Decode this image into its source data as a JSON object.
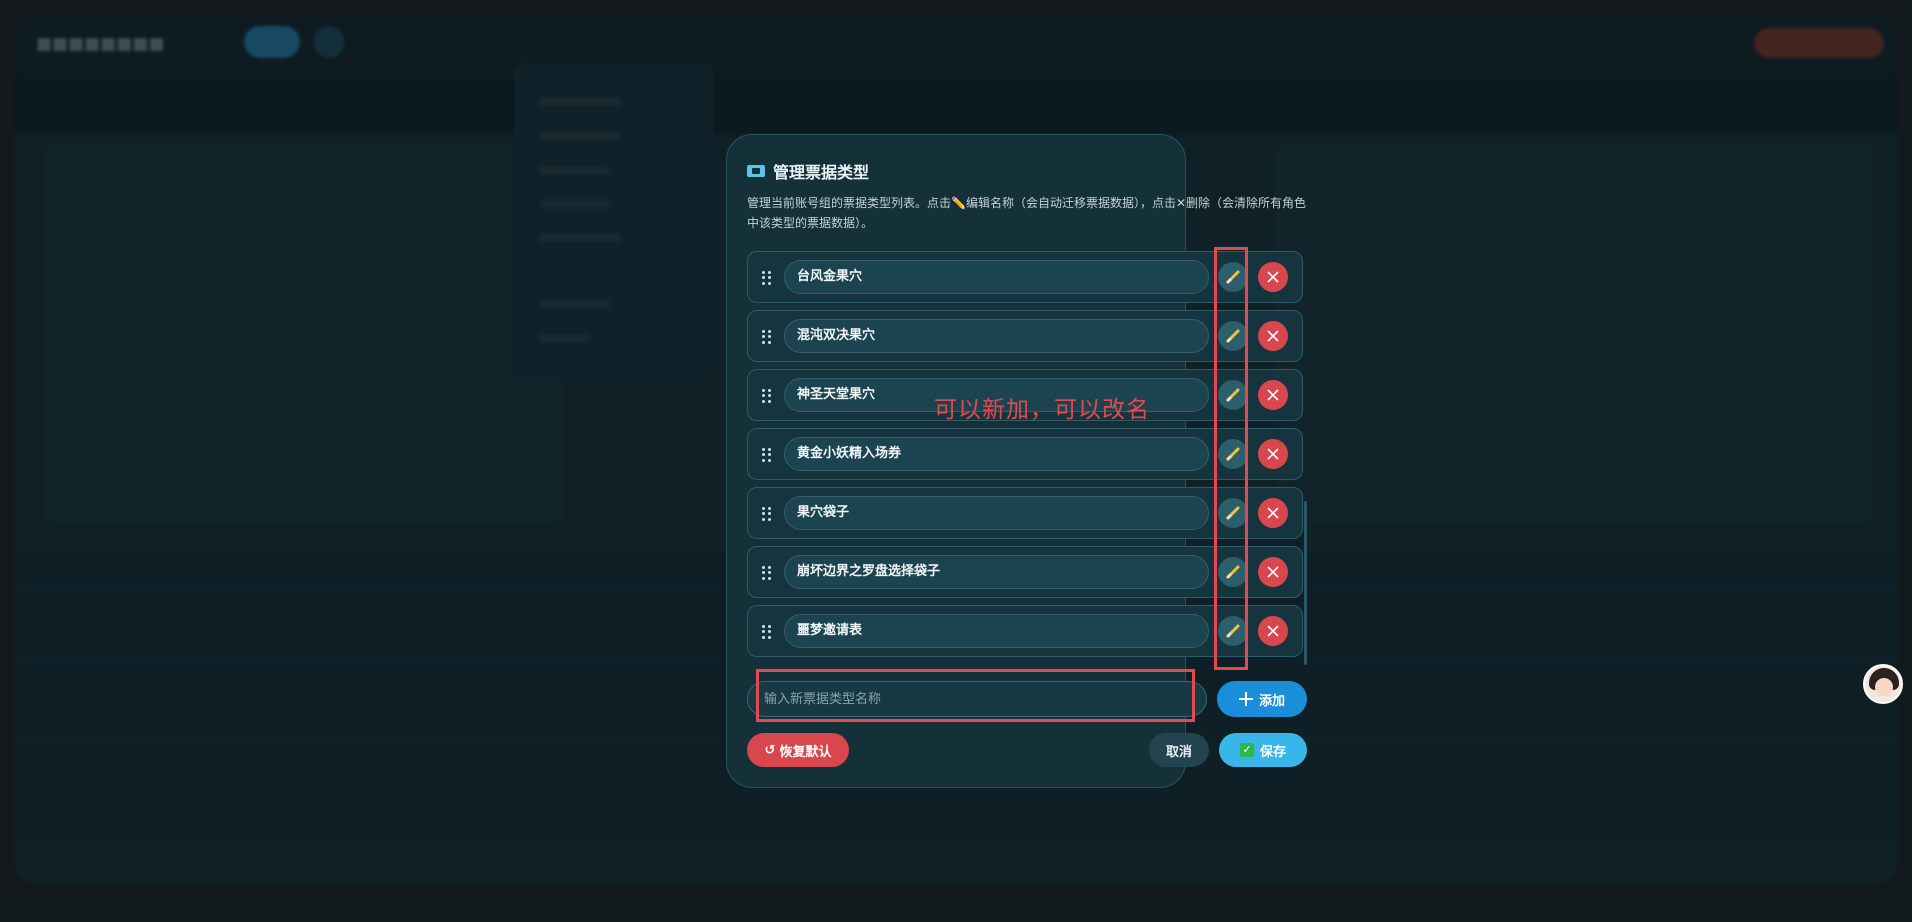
{
  "background": {
    "app_title": "■■■■■■■■"
  },
  "modal": {
    "title": "管理票据类型",
    "description": "管理当前账号组的票据类型列表。点击✏️编辑名称（会自动迁移票据数据），点击✕删除（会清除所有角色中该类型的票据数据）。",
    "types": [
      {
        "name": "台风金果穴"
      },
      {
        "name": "混沌双决果穴"
      },
      {
        "name": "神圣天堂果穴"
      },
      {
        "name": "黄金小妖精入场券"
      },
      {
        "name": "果穴袋子"
      },
      {
        "name": "崩坏边界之罗盘选择袋子"
      },
      {
        "name": "噩梦邀请表"
      }
    ],
    "new_type_placeholder": "输入新票据类型名称",
    "add_label": "添加",
    "reset_label": "恢复默认",
    "cancel_label": "取消",
    "save_label": "保存"
  },
  "annotation": {
    "note": "可以新加，可以改名"
  },
  "colors": {
    "accent_blue": "#1a8ed8",
    "danger_red": "#d8474d",
    "annotation_red": "#e24a4f",
    "modal_bg": "#143038"
  }
}
